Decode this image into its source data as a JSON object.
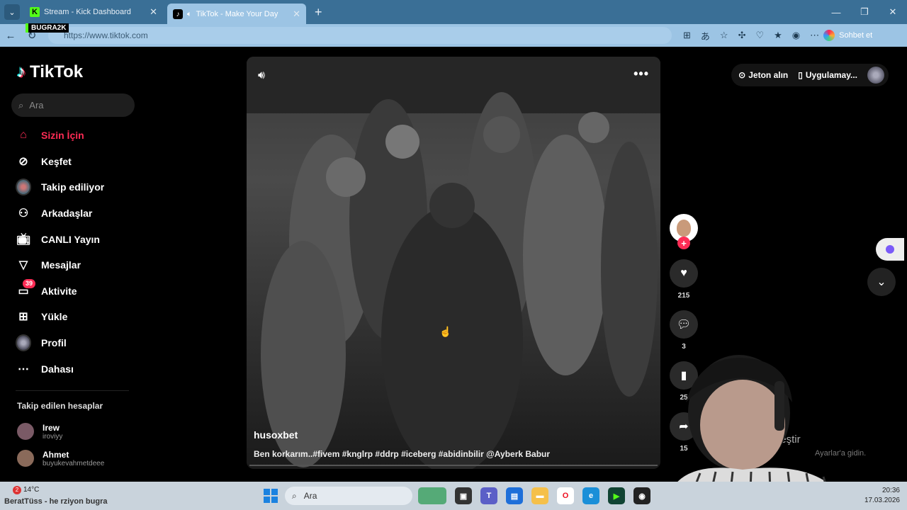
{
  "browser": {
    "tabs": [
      {
        "title": "Stream - Kick Dashboard",
        "active": false
      },
      {
        "title": "TikTok - Make Your Day",
        "active": true
      }
    ],
    "url": "https://www.tiktok.com",
    "sohbet_label": "Sohbet et",
    "stream_overlay": "BUGRA2K"
  },
  "sidebar": {
    "logo": "TikTok",
    "search_placeholder": "Ara",
    "nav": [
      {
        "label": "Sizin İçin",
        "icon": "home-icon",
        "active": true
      },
      {
        "label": "Keşfet",
        "icon": "compass-icon"
      },
      {
        "label": "Takip ediliyor",
        "icon": "following-avatar"
      },
      {
        "label": "Arkadaşlar",
        "icon": "friends-icon"
      },
      {
        "label": "CANLI Yayın",
        "icon": "live-icon"
      },
      {
        "label": "Mesajlar",
        "icon": "send-icon"
      },
      {
        "label": "Aktivite",
        "icon": "inbox-icon",
        "badge": "39"
      },
      {
        "label": "Yükle",
        "icon": "upload-icon"
      },
      {
        "label": "Profil",
        "icon": "profile-avatar"
      },
      {
        "label": "Dahası",
        "icon": "more-icon"
      }
    ],
    "followed_title": "Takip edilen hesaplar",
    "followed": [
      {
        "name": "Irew",
        "handle": "iroviyy"
      },
      {
        "name": "Ahmet",
        "handle": "buyukevahmetdeee"
      }
    ]
  },
  "topbar": {
    "coins_label": "Jeton alın",
    "app_label": "Uygulamay..."
  },
  "video": {
    "author": "husoxbet",
    "caption": "Ben korkarım..#fivem #knglrp #ddrp #iceberg #abidinbilir @Ayberk Babur"
  },
  "actions": {
    "likes": "215",
    "comments": "3",
    "saves": "25",
    "shares": "15"
  },
  "activation": {
    "title": "Windows'u etkinleştir",
    "subtitle": "Ayarlar'a gidin."
  },
  "taskbar": {
    "temperature": "14°C",
    "weather_badge": "2",
    "overlay_name": "BeratTüss - he rziyon bugra",
    "search_placeholder": "Ara",
    "time": "20:36",
    "date": "17.03.2026"
  },
  "colors": {
    "accent": "#fe2c55",
    "tabbar": "#3a6f96",
    "addrbar": "#9cc4e4"
  }
}
